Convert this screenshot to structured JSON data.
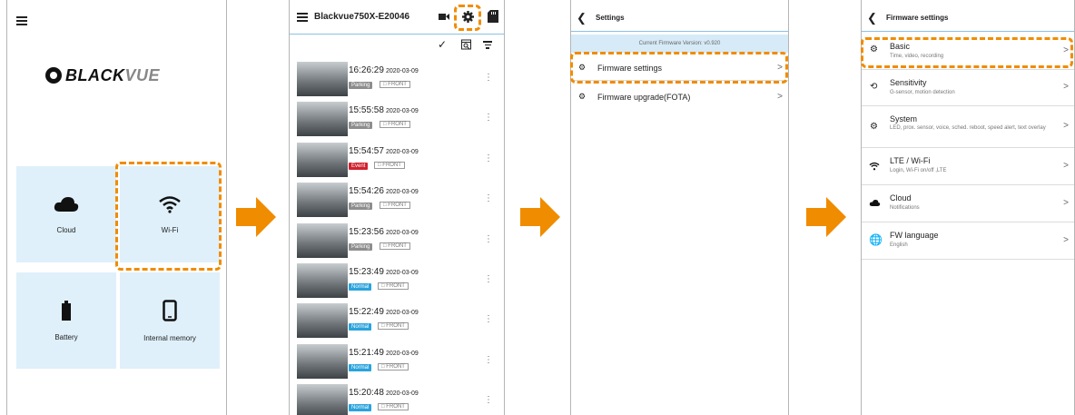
{
  "screen1": {
    "brand": {
      "black": "BLACK",
      "vue": "VUE"
    },
    "tiles": [
      {
        "label": "Cloud",
        "icon": "cloud-icon"
      },
      {
        "label": "Wi-Fi",
        "icon": "wifi-icon"
      },
      {
        "label": "Battery",
        "icon": "battery-icon"
      },
      {
        "label": "Internal memory",
        "icon": "phone-icon"
      }
    ]
  },
  "screen2": {
    "title": "Blackvue750X-E20046",
    "videos": [
      {
        "time": "16:26:29",
        "date": "2020-03-09",
        "type": "Parking",
        "cam": "FRONT"
      },
      {
        "time": "15:55:58",
        "date": "2020-03-09",
        "type": "Parking",
        "cam": "FRONT"
      },
      {
        "time": "15:54:57",
        "date": "2020-03-09",
        "type": "Event",
        "cam": "FRONT"
      },
      {
        "time": "15:54:26",
        "date": "2020-03-09",
        "type": "Parking",
        "cam": "FRONT"
      },
      {
        "time": "15:23:56",
        "date": "2020-03-09",
        "type": "Parking",
        "cam": "FRONT"
      },
      {
        "time": "15:23:49",
        "date": "2020-03-09",
        "type": "Normal",
        "cam": "FRONT"
      },
      {
        "time": "15:22:49",
        "date": "2020-03-09",
        "type": "Normal",
        "cam": "FRONT"
      },
      {
        "time": "15:21:49",
        "date": "2020-03-09",
        "type": "Normal",
        "cam": "FRONT"
      },
      {
        "time": "15:20:48",
        "date": "2020-03-09",
        "type": "Normal",
        "cam": "FRONT"
      }
    ]
  },
  "screen3": {
    "title": "Settings",
    "fw_version": "Current Firmware Version: v0.920",
    "items": [
      {
        "label": "Firmware settings"
      },
      {
        "label": "Firmware upgrade(FOTA)"
      }
    ]
  },
  "screen4": {
    "title": "Firmware settings",
    "items": [
      {
        "label": "Basic",
        "sub": "Time, video, recording",
        "icon": "gear-icon"
      },
      {
        "label": "Sensitivity",
        "sub": "G-sensor, motion detection",
        "icon": "vibration-icon"
      },
      {
        "label": "System",
        "sub": "LED, prox. sensor, voice, sched. reboot, speed alert, text overlay",
        "icon": "gears-icon"
      },
      {
        "label": "LTE / Wi-Fi",
        "sub": "Login, Wi-Fi on/off ,LTE",
        "icon": "wifi-icon"
      },
      {
        "label": "Cloud",
        "sub": "Notifications",
        "icon": "cloud-icon"
      },
      {
        "label": "FW language",
        "sub": "English",
        "icon": "globe-icon"
      }
    ]
  },
  "colors": {
    "highlight": "#f08c00",
    "accent": "#8bc1e4",
    "tile": "#dff0fa",
    "event": "#d0222f",
    "normal": "#2aa3dd",
    "parking": "#8d8d8d"
  }
}
